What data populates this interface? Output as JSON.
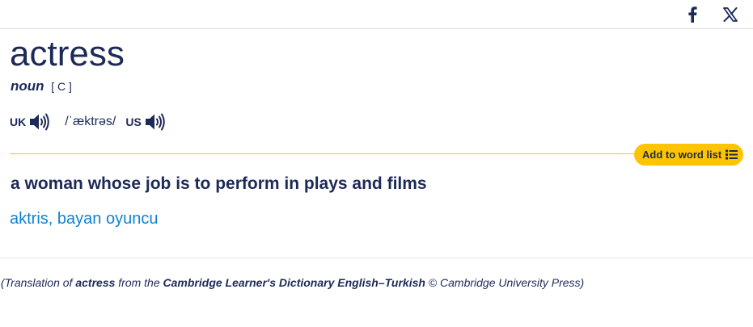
{
  "social": {
    "facebook_icon": "facebook-f-icon",
    "x_icon": "x-logo-icon"
  },
  "entry": {
    "headword": "actress",
    "pos": "noun",
    "grammar": "[ C ]",
    "pronunciation": {
      "uk_label": "UK",
      "us_label": "US",
      "ipa": "/ˈæktrəs/"
    },
    "add_to_word_list": "Add to word list",
    "definition": "a woman whose job is to perform in plays and films",
    "translation": "aktris, bayan oyuncu"
  },
  "credit": {
    "prefix": "(Translation of ",
    "word": "actress",
    "middle": " from the ",
    "dictionary": "Cambridge Learner's Dictionary English–Turkish",
    "suffix": " © Cambridge University Press)"
  },
  "colors": {
    "navy": "#1d2a57",
    "accent_yellow": "#fec400",
    "link_blue": "#0e83d5"
  }
}
